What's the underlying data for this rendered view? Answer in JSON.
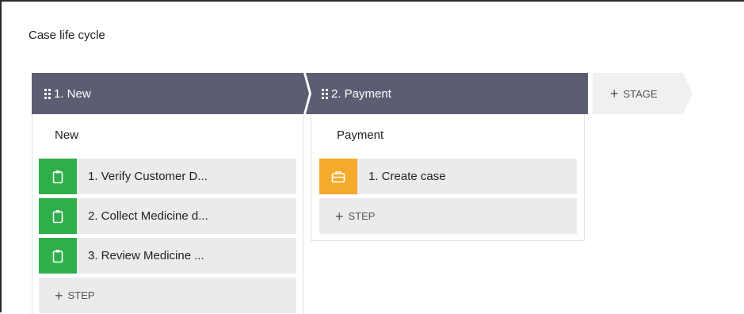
{
  "panel": {
    "title": "Case life cycle"
  },
  "stages": [
    {
      "header": "1.  New",
      "process": "New",
      "steps": [
        {
          "label": "1.  Verify Customer D...",
          "icon": "clipboard-icon",
          "color": "#2eaf4a"
        },
        {
          "label": "2.  Collect Medicine d...",
          "icon": "clipboard-icon",
          "color": "#2eaf4a"
        },
        {
          "label": "3.  Review Medicine ...",
          "icon": "clipboard-icon",
          "color": "#2eaf4a"
        }
      ],
      "add_step": "STEP"
    },
    {
      "header": "2.  Payment",
      "process": "Payment",
      "steps": [
        {
          "label": "1.  Create case",
          "icon": "briefcase-icon",
          "color": "#f5aa2c"
        }
      ],
      "add_step": "STEP"
    }
  ],
  "add_stage": "STAGE",
  "colors": {
    "header": "#5b5e72",
    "step_bg": "#ebebee",
    "assignment": "#2eaf4a",
    "case_step": "#f5aa2c"
  }
}
